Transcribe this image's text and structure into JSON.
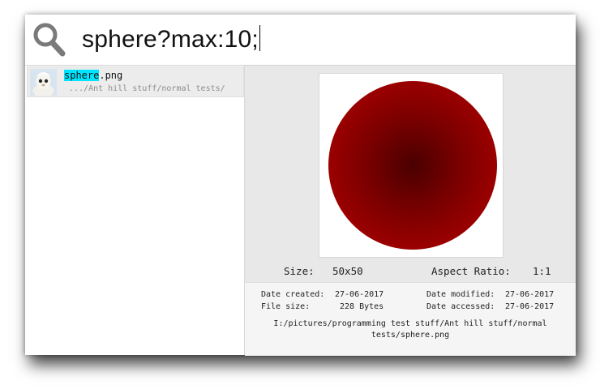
{
  "search": {
    "query": "sphere?max:10;"
  },
  "results": [
    {
      "name_match": "sphere",
      "name_rest": ".png",
      "path": ".../Ant hill stuff/normal tests/"
    }
  ],
  "preview": {
    "size_label": "Size:",
    "size_value": "50x50",
    "aspect_label": "Aspect Ratio:",
    "aspect_value": "1:1",
    "created_label": "Date created:",
    "created_value": "27-06-2017",
    "modified_label": "Date modified:",
    "modified_value": "27-06-2017",
    "filesize_label": "File size:",
    "filesize_value": "228 Bytes",
    "accessed_label": "Date accessed:",
    "accessed_value": "27-06-2017",
    "full_path": "I:/pictures/programming test stuff/Ant hill stuff/normal tests/sphere.png"
  },
  "colors": {
    "highlight": "#00e5ff",
    "sphere_edge": "#9b0000",
    "sphere_center": "#4a0000"
  }
}
